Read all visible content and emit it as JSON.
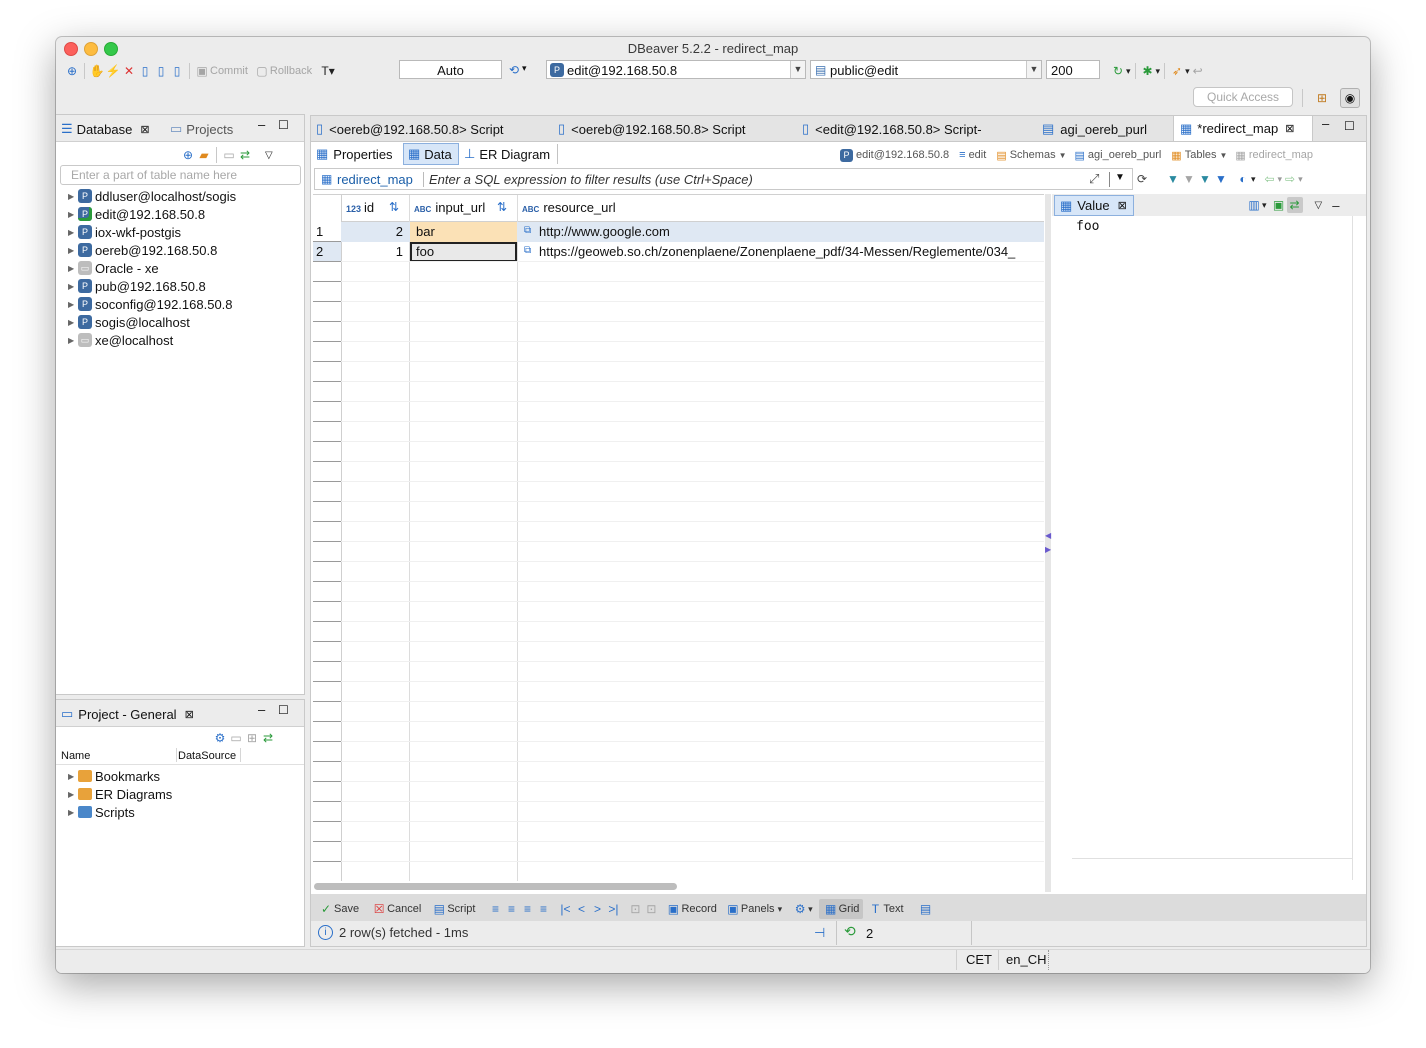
{
  "window": {
    "title": "DBeaver 5.2.2 - redirect_map"
  },
  "toolbar": {
    "commit": "Commit",
    "rollback": "Rollback",
    "transaction_mode": "Auto",
    "connection": "edit@192.168.50.8",
    "schema": "public@edit",
    "result_limit": "200",
    "quick_access_placeholder": "Quick Access"
  },
  "navigator": {
    "tab_database": "Database",
    "tab_projects": "Projects",
    "filter_placeholder": "Enter a part of table name here",
    "connections": [
      "ddluser@localhost/sogis",
      "edit@192.168.50.8",
      "iox-wkf-postgis",
      "oereb@192.168.50.8",
      "Oracle - xe",
      "pub@192.168.50.8",
      "soconfig@192.168.50.8",
      "sogis@localhost",
      "xe@localhost"
    ]
  },
  "project": {
    "title": "Project - General",
    "col_name": "Name",
    "col_datasource": "DataSource",
    "items": [
      "Bookmarks",
      "ER Diagrams",
      "Scripts"
    ]
  },
  "editor_tabs": [
    "<oereb@192.168.50.8> Script",
    "<oereb@192.168.50.8> Script",
    "<edit@192.168.50.8> Script-",
    "agi_oereb_purl",
    "*redirect_map"
  ],
  "subtabs": {
    "properties": "Properties",
    "data": "Data",
    "er": "ER Diagram"
  },
  "breadcrumb": {
    "connection": "edit@192.168.50.8",
    "database": "edit",
    "schemas": "Schemas",
    "schema": "agi_oereb_purl",
    "tables": "Tables",
    "table": "redirect_map"
  },
  "filter": {
    "table": "redirect_map",
    "placeholder": "Enter a SQL expression to filter results (use Ctrl+Space)"
  },
  "grid": {
    "columns": [
      {
        "type": "123",
        "name": "id"
      },
      {
        "type": "ABC",
        "name": "input_url"
      },
      {
        "type": "ABC",
        "name": "resource_url"
      }
    ],
    "rows": [
      {
        "num": "1",
        "id": "2",
        "input_url": "bar",
        "resource_url": "http://www.google.com"
      },
      {
        "num": "2",
        "id": "1",
        "input_url": "foo",
        "resource_url": "https://geoweb.so.ch/zonenplaene/Zonenplaene_pdf/34-Messen/Reglemente/034_"
      }
    ]
  },
  "value_panel": {
    "title": "Value",
    "content": "foo"
  },
  "bottom_toolbar": {
    "save": "Save",
    "cancel": "Cancel",
    "script": "Script",
    "record": "Record",
    "panels": "Panels",
    "grid": "Grid",
    "text": "Text"
  },
  "status": {
    "message": "2 row(s) fetched - 1ms",
    "count": "2",
    "timezone": "CET",
    "locale": "en_CH"
  }
}
